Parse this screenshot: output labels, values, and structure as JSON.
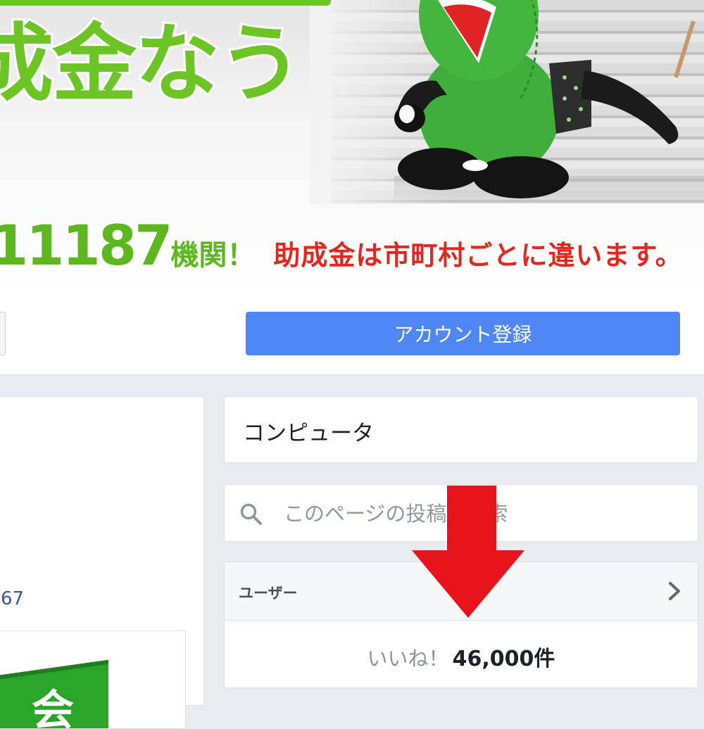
{
  "cover": {
    "title": "成金なう",
    "stat_number": "11187",
    "stat_unit": "機関！",
    "stat_note": "助成金は市町村ごとに違います。"
  },
  "action_bar": {
    "account_button_label": "アカウント登録"
  },
  "left_column": {
    "link_text": "67",
    "logo_glyph": "会"
  },
  "category": {
    "text": "コンピュータ"
  },
  "search": {
    "placeholder": "このページの投稿を検索",
    "icon": "search-icon"
  },
  "users_section": {
    "title": "ユーザー",
    "chevron_icon": "chevron-right-icon",
    "likes_label": "いいね！",
    "likes_count": "46,000件"
  },
  "colors": {
    "brand_green": "#6cc425",
    "note_red": "#e2271f",
    "button_blue": "#4e87f5",
    "arrow_red": "#e8141c",
    "page_bg": "#e9ebee"
  },
  "overlay": {
    "arrow_icon": "red-down-arrow-icon"
  }
}
